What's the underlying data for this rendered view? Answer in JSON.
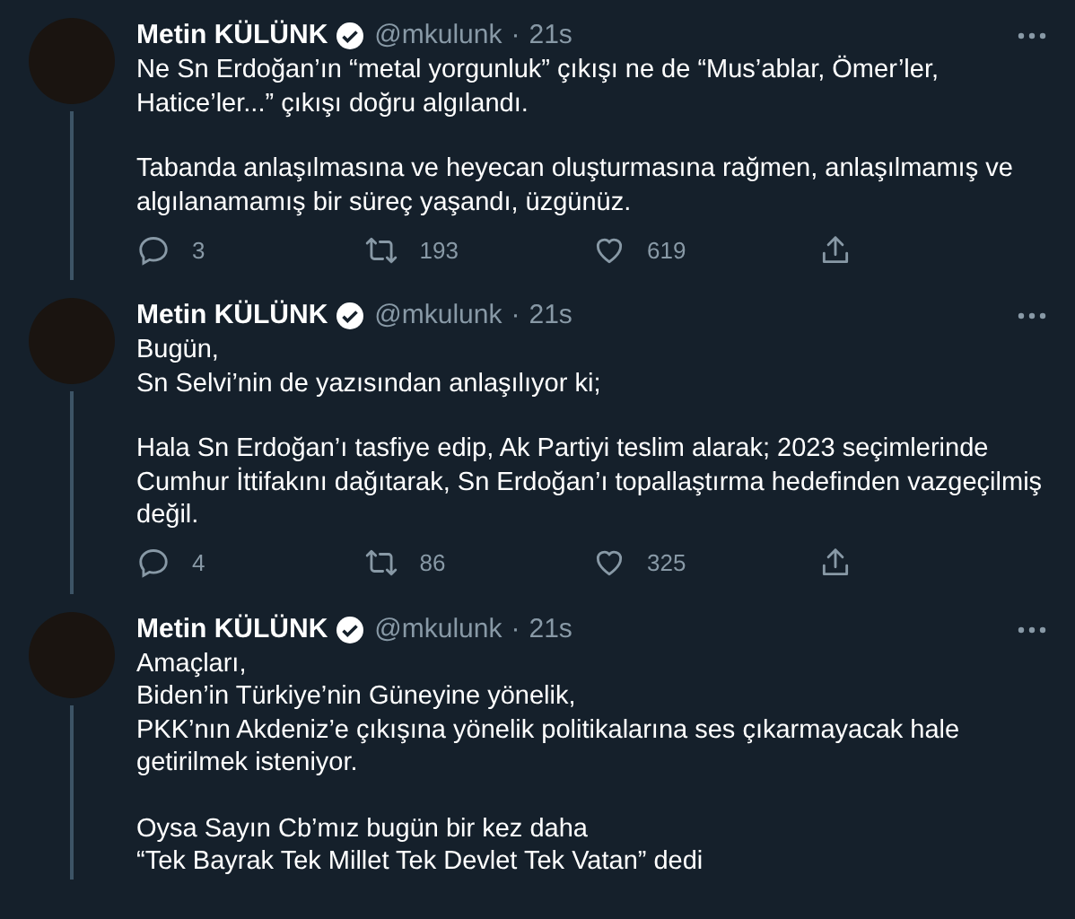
{
  "tweets": [
    {
      "name": "Metin KÜLÜNK",
      "verified": true,
      "handle": "@mkulunk",
      "separator": "·",
      "time": "21s",
      "thread_line": true,
      "paragraphs": [
        "Ne Sn Erdoğan’ın “metal yorgunluk” çıkışı ne de “Mus’ablar, Ömer’ler, Hatice’ler...” çıkışı doğru algılandı.",
        "Tabanda anlaşılmasına ve heyecan oluşturmasına rağmen, anlaşılmamış ve algılanamamış bir süreç yaşandı, üzgünüz."
      ],
      "replies": "3",
      "retweets": "193",
      "likes": "619"
    },
    {
      "name": "Metin KÜLÜNK",
      "verified": true,
      "handle": "@mkulunk",
      "separator": "·",
      "time": "21s",
      "thread_line": true,
      "paragraphs": [
        "Bugün,\nSn Selvi’nin de yazısından anlaşılıyor ki;",
        "Hala Sn Erdoğan’ı tasfiye edip, Ak Partiyi teslim alarak; 2023 seçimlerinde Cumhur İttifakını dağıtarak, Sn Erdoğan’ı topallaştırma hedefinden vazgeçilmiş değil."
      ],
      "replies": "4",
      "retweets": "86",
      "likes": "325"
    },
    {
      "name": "Metin KÜLÜNK",
      "verified": true,
      "handle": "@mkulunk",
      "separator": "·",
      "time": "21s",
      "thread_line": true,
      "paragraphs": [
        "Amaçları,\nBiden’in Türkiye’nin Güneyine yönelik,\nPKK’nın Akdeniz’e çıkışına yönelik politikalarına ses çıkarmayacak hale getirilmek isteniyor.",
        "Oysa Sayın Cb’mız bugün bir kez daha\n“Tek Bayrak Tek Millet Tek Devlet Tek Vatan” dedi"
      ]
    }
  ]
}
